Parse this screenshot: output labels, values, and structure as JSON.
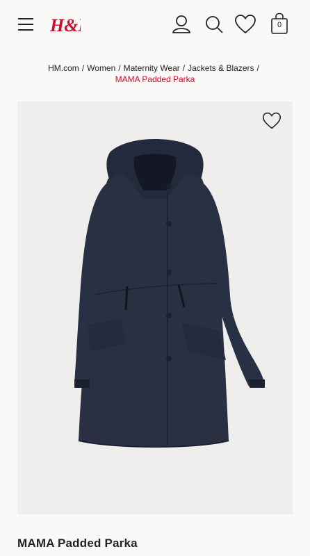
{
  "header": {
    "brand": "H&M",
    "bag_count": "0"
  },
  "breadcrumb": {
    "items": [
      "HM.com",
      "Women",
      "Maternity Wear",
      "Jackets & Blazers"
    ],
    "separator": "/",
    "current": "MAMA Padded Parka"
  },
  "product": {
    "title": "MAMA Padded Parka",
    "image_alt": "Navy padded parka with hood"
  },
  "colors": {
    "accent": "#c8102e",
    "coat": "#2a3042"
  }
}
